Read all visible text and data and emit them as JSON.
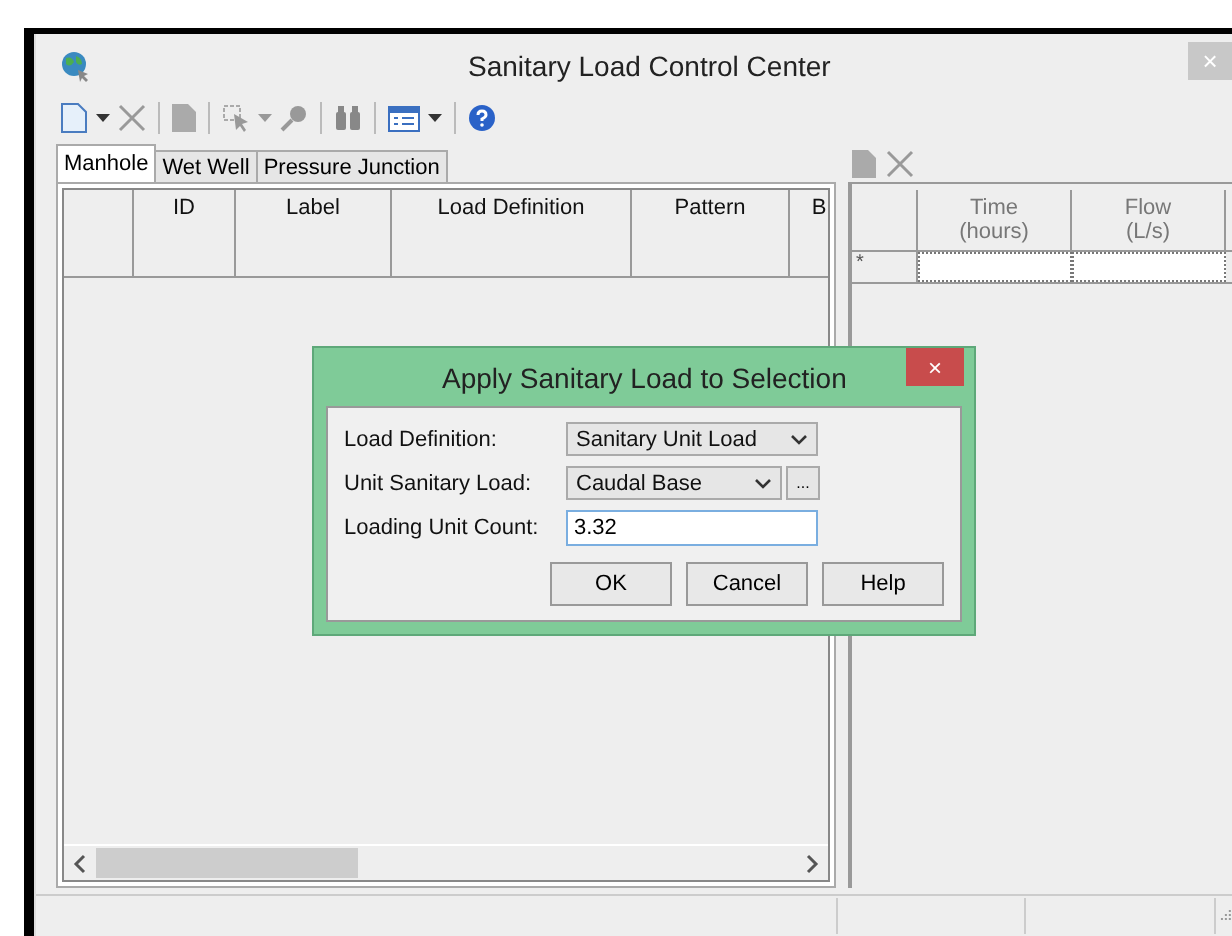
{
  "window": {
    "title": "Sanitary Load Control Center",
    "close": "×"
  },
  "tabs": [
    {
      "label": "Manhole",
      "selected": true
    },
    {
      "label": "Wet Well",
      "selected": false
    },
    {
      "label": "Pressure Junction",
      "selected": false
    }
  ],
  "grid": {
    "columns": [
      "ID",
      "Label",
      "Load Definition",
      "Pattern",
      "B"
    ]
  },
  "pattern_grid": {
    "columns": [
      {
        "label": "Time",
        "unit": "(hours)"
      },
      {
        "label": "Flow",
        "unit": "(L/s)"
      }
    ],
    "new_row_marker": "*"
  },
  "dialog": {
    "title": "Apply Sanitary Load to Selection",
    "close": "×",
    "fields": [
      {
        "kind": "dropdown",
        "label": "Load Definition:",
        "value": "Sanitary Unit Load"
      },
      {
        "kind": "dropdown_browse",
        "label": "Unit Sanitary Load:",
        "value": "Caudal Base",
        "extra": "..."
      },
      {
        "kind": "text",
        "label": "Loading Unit Count:",
        "value": "3.32"
      }
    ],
    "buttons": [
      "OK",
      "Cancel",
      "Help"
    ]
  }
}
